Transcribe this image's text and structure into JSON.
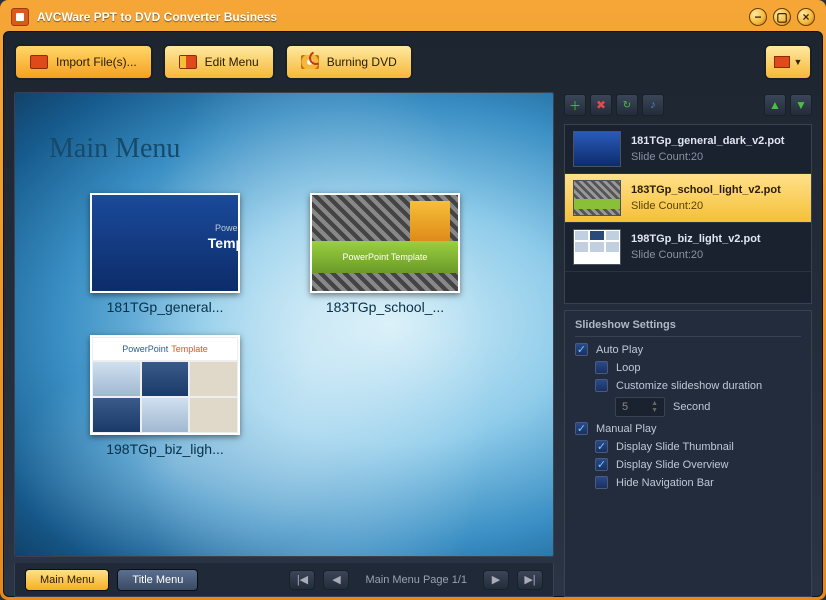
{
  "app": {
    "title": "AVCWare PPT to DVD Converter Business"
  },
  "toolbar": {
    "import": "Import File(s)...",
    "edit_menu": "Edit Menu",
    "burning": "Burning DVD"
  },
  "preview": {
    "menu_title": "Main Menu",
    "thumbs": [
      {
        "label": "181TGp_general..."
      },
      {
        "label": "183TGp_school_..."
      },
      {
        "label": "198TGp_biz_ligh..."
      }
    ],
    "nav": {
      "main": "Main Menu",
      "title": "Title Menu",
      "page": "Main Menu Page 1/1"
    }
  },
  "files": [
    {
      "name": "181TGp_general_dark_v2.pot",
      "count": "Slide Count:20",
      "thumb": "t1s",
      "selected": false
    },
    {
      "name": "183TGp_school_light_v2.pot",
      "count": "Slide Count:20",
      "thumb": "t2s",
      "selected": true
    },
    {
      "name": "198TGp_biz_light_v2.pot",
      "count": "Slide Count:20",
      "thumb": "t3s",
      "selected": false
    }
  ],
  "settings": {
    "heading": "Slideshow Settings",
    "auto_play": "Auto Play",
    "loop": "Loop",
    "customize": "Customize slideshow duration",
    "duration_value": "5",
    "second": "Second",
    "manual_play": "Manual Play",
    "thumbnail": "Display Slide Thumbnail",
    "overview": "Display Slide Overview",
    "hide_nav": "Hide Navigation Bar"
  }
}
